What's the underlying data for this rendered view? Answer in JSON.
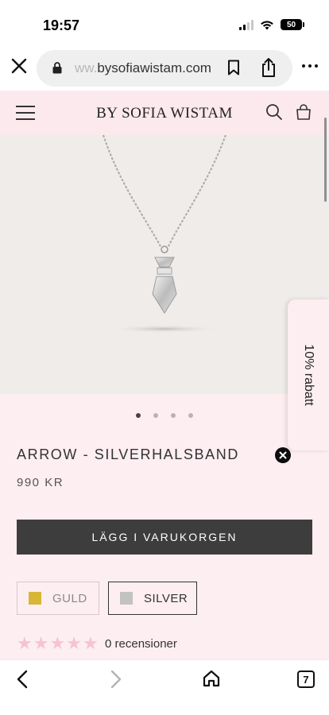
{
  "status_bar": {
    "time": "19:57",
    "battery": "50"
  },
  "browser": {
    "url_prefix": "ww.",
    "url_domain": "bysofiawistam.com",
    "tab_count": "7"
  },
  "header": {
    "brand": "BY SOFIA WISTAM"
  },
  "carousel": {
    "total": 4,
    "active_index": 0
  },
  "product": {
    "title": "ARROW - SILVERHALSBAND",
    "price": "990 KR",
    "add_to_cart": "LÄGG I VARUKORGEN",
    "variants": [
      {
        "label": "GULD",
        "color": "#d8b636",
        "selected": false
      },
      {
        "label": "SILVER",
        "color": "#c2c2c2",
        "selected": true
      }
    ],
    "rating": 0,
    "reviews": "0 recensioner"
  },
  "side_tab": {
    "label": "10% rabatt"
  },
  "colors": {
    "accent_pink": "#fce9ee",
    "button_dark": "#3e3d3d",
    "star_pink": "#f7c3d2"
  }
}
